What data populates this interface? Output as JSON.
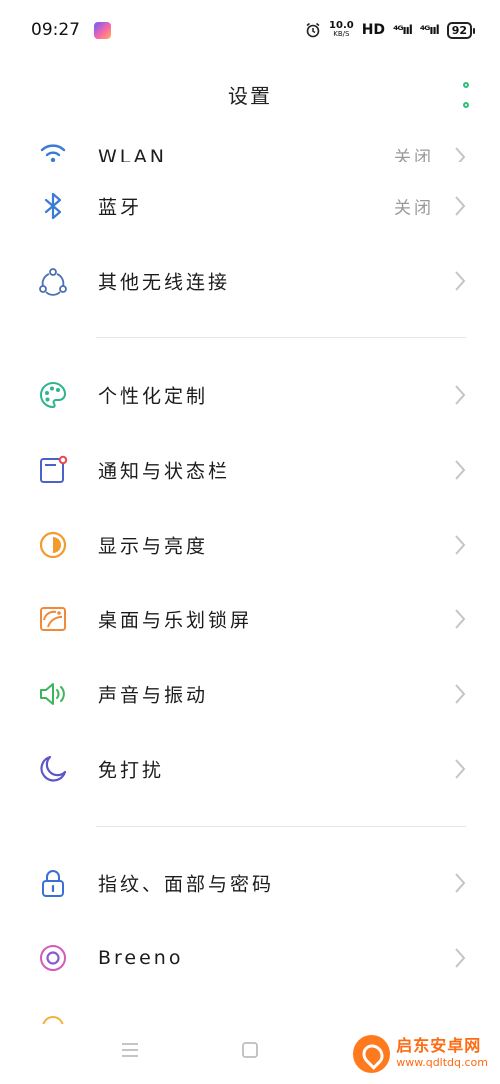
{
  "status_bar": {
    "time": "09:27",
    "net_speed": "10.0",
    "net_unit": "KB/S",
    "hd": "HD",
    "signal1": "⁴ᴳııl",
    "signal2": "⁴ᴳııl",
    "battery": "92"
  },
  "header": {
    "title": "设置"
  },
  "settings": [
    {
      "label": "WLAN",
      "value": "关闭",
      "icon": "wifi-icon",
      "color": "#3a7bd5"
    },
    {
      "label": "蓝牙",
      "value": "关闭",
      "icon": "bluetooth-icon",
      "color": "#3a7bd5"
    },
    {
      "label": "其他无线连接",
      "value": "",
      "icon": "connection-icon",
      "color": "#4a6fb5"
    },
    {
      "label": "个性化定制",
      "value": "",
      "icon": "palette-icon",
      "color": "#2cb58e"
    },
    {
      "label": "通知与状态栏",
      "value": "",
      "icon": "notification-icon",
      "color": "#4a62c9"
    },
    {
      "label": "显示与亮度",
      "value": "",
      "icon": "brightness-icon",
      "color": "#f29a2e"
    },
    {
      "label": "桌面与乐划锁屏",
      "value": "",
      "icon": "wallpaper-icon",
      "color": "#f08a3a"
    },
    {
      "label": "声音与振动",
      "value": "",
      "icon": "sound-icon",
      "color": "#3cb55a"
    },
    {
      "label": "免打扰",
      "value": "",
      "icon": "moon-icon",
      "color": "#5a55c9"
    },
    {
      "label": "指纹、面部与密码",
      "value": "",
      "icon": "lock-icon",
      "color": "#3a6fd5"
    },
    {
      "label": "Breeno",
      "value": "",
      "icon": "breeno-icon",
      "color": "#d45ab8"
    }
  ],
  "watermark": {
    "title": "启东安卓网",
    "url": "www.qdltdq.com"
  }
}
